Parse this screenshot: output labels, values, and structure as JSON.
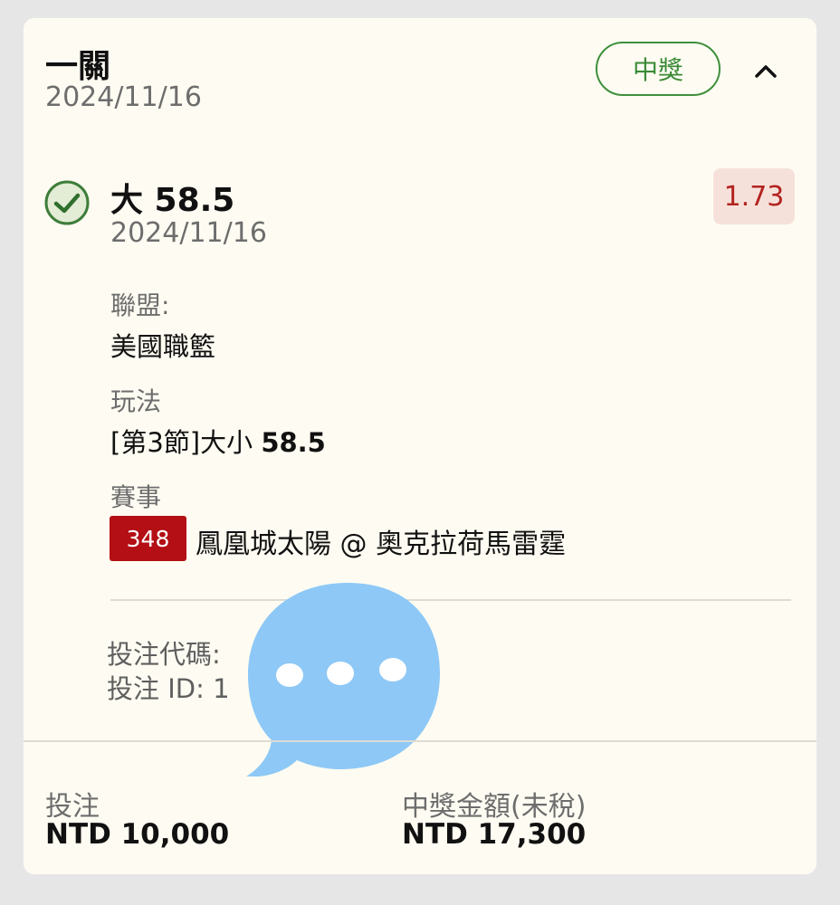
{
  "ticket": {
    "bet_type": "一關",
    "date": "2024/11/16",
    "status": "中獎",
    "status_color": "#3a8a36"
  },
  "selection": {
    "pick": "大 58.5",
    "date": "2024/11/16",
    "odds": "1.73",
    "odds_color": "#b3231f",
    "result_icon": "check-circle-icon"
  },
  "details": {
    "league_label": "聯盟:",
    "league_value": "美國職籃",
    "market_label": "玩法",
    "market_prefix": "[第3節]大小",
    "market_line": "58.5",
    "event_label": "賽事",
    "event_id": "348",
    "event_name": "鳳凰城太陽 @ 奧克拉荷馬雷霆"
  },
  "meta": {
    "bet_code": "投注代碼:",
    "bet_id": "投注 ID: 1"
  },
  "footer": {
    "stake_label": "投注",
    "stake_value": "NTD 10,000",
    "payout_label": "中獎金額(未稅)",
    "payout_value": "NTD 17,300"
  },
  "overlay": {
    "icon": "chat-bubble-icon",
    "color": "#8ec8f6"
  }
}
